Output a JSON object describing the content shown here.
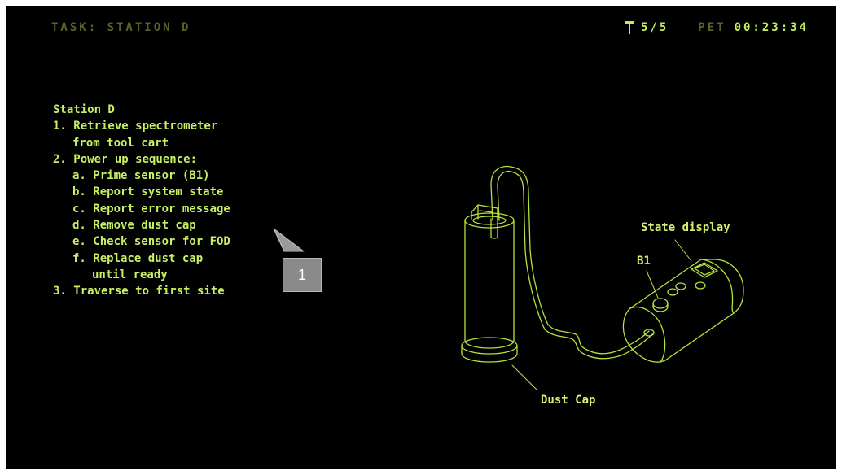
{
  "header": {
    "task": "TASK: STATION D",
    "count": "5/5",
    "pet_label": "PET",
    "pet_time": "00:23:34"
  },
  "procedure": {
    "title": "Station D",
    "steps": [
      "1. Retrieve spectrometer",
      "from tool cart",
      "2. Power up sequence:",
      "a. Prime sensor (B1)",
      "b. Report system state",
      "c. Report error message",
      "d. Remove dust cap",
      "e. Check sensor for FOD",
      "f. Replace dust cap",
      "until ready",
      "3. Traverse to first site"
    ]
  },
  "diagram": {
    "state_display_label": "State display",
    "b1_label": "B1",
    "dust_cap_label": "Dust Cap"
  },
  "callout": {
    "number": "1"
  },
  "colors": {
    "background": "#000000",
    "text": "#c7f065",
    "dim_text": "#55632b",
    "line_art": "#b5e23c"
  },
  "icons": {
    "marker": "pin-icon"
  }
}
